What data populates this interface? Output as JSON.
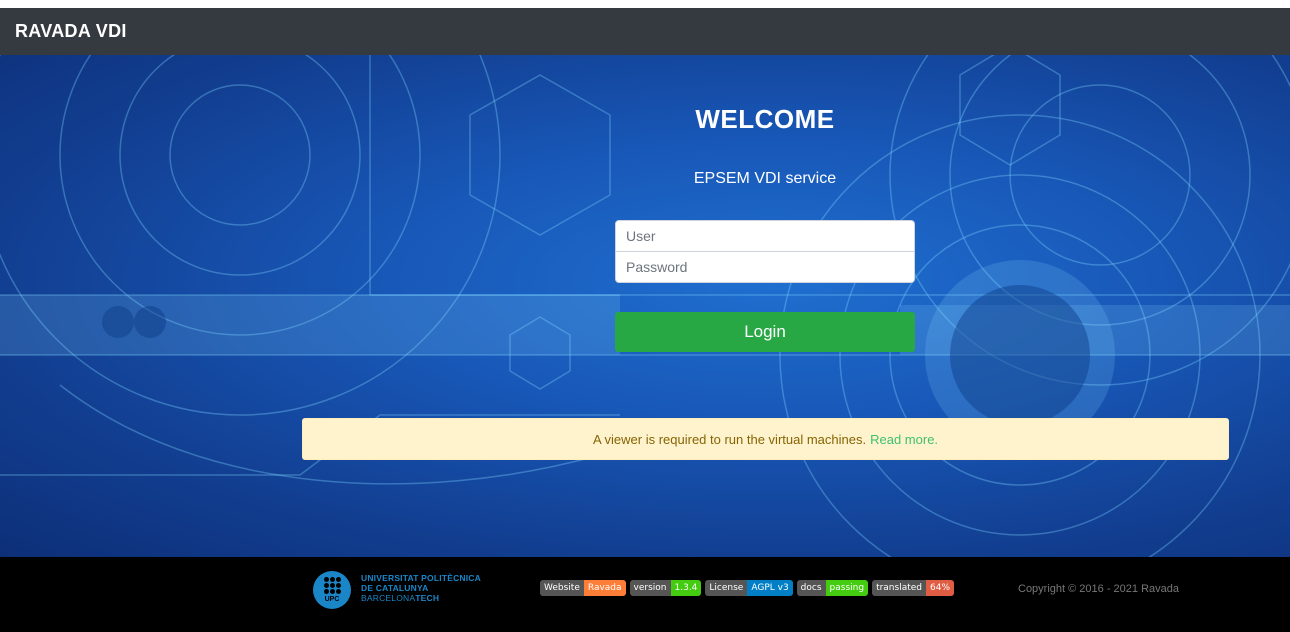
{
  "navbar": {
    "brand": "RAVADA VDI"
  },
  "hero": {
    "welcome": "WELCOME",
    "service": "EPSEM VDI service"
  },
  "login": {
    "user_placeholder": "User",
    "password_placeholder": "Password",
    "button_label": "Login"
  },
  "alert": {
    "text": "A viewer is required to run the virtual machines.",
    "link_text": "Read more."
  },
  "footer": {
    "logo": {
      "abbr": "UPC",
      "line1": "UNIVERSITAT POLITÈCNICA",
      "line2": "DE CATALUNYA",
      "line3_light": "BARCELONA",
      "line3_bold": "TECH"
    },
    "badges": [
      {
        "label": "Website",
        "value": "Ravada",
        "color": "#fe7d37"
      },
      {
        "label": "version",
        "value": "1.3.4",
        "color": "#4c1"
      },
      {
        "label": "License",
        "value": "AGPL v3",
        "color": "#007ec6"
      },
      {
        "label": "docs",
        "value": "passing",
        "color": "#4c1"
      },
      {
        "label": "translated",
        "value": "64%",
        "color": "#e05d44"
      }
    ],
    "copyright": "Copyright © 2016 - 2021 Ravada"
  },
  "colors": {
    "navbar": "#343a40",
    "login_button": "#28a745",
    "alert_bg": "#fff3cd",
    "alert_link": "#3fbf6f",
    "upc_blue": "#1a86c8"
  }
}
